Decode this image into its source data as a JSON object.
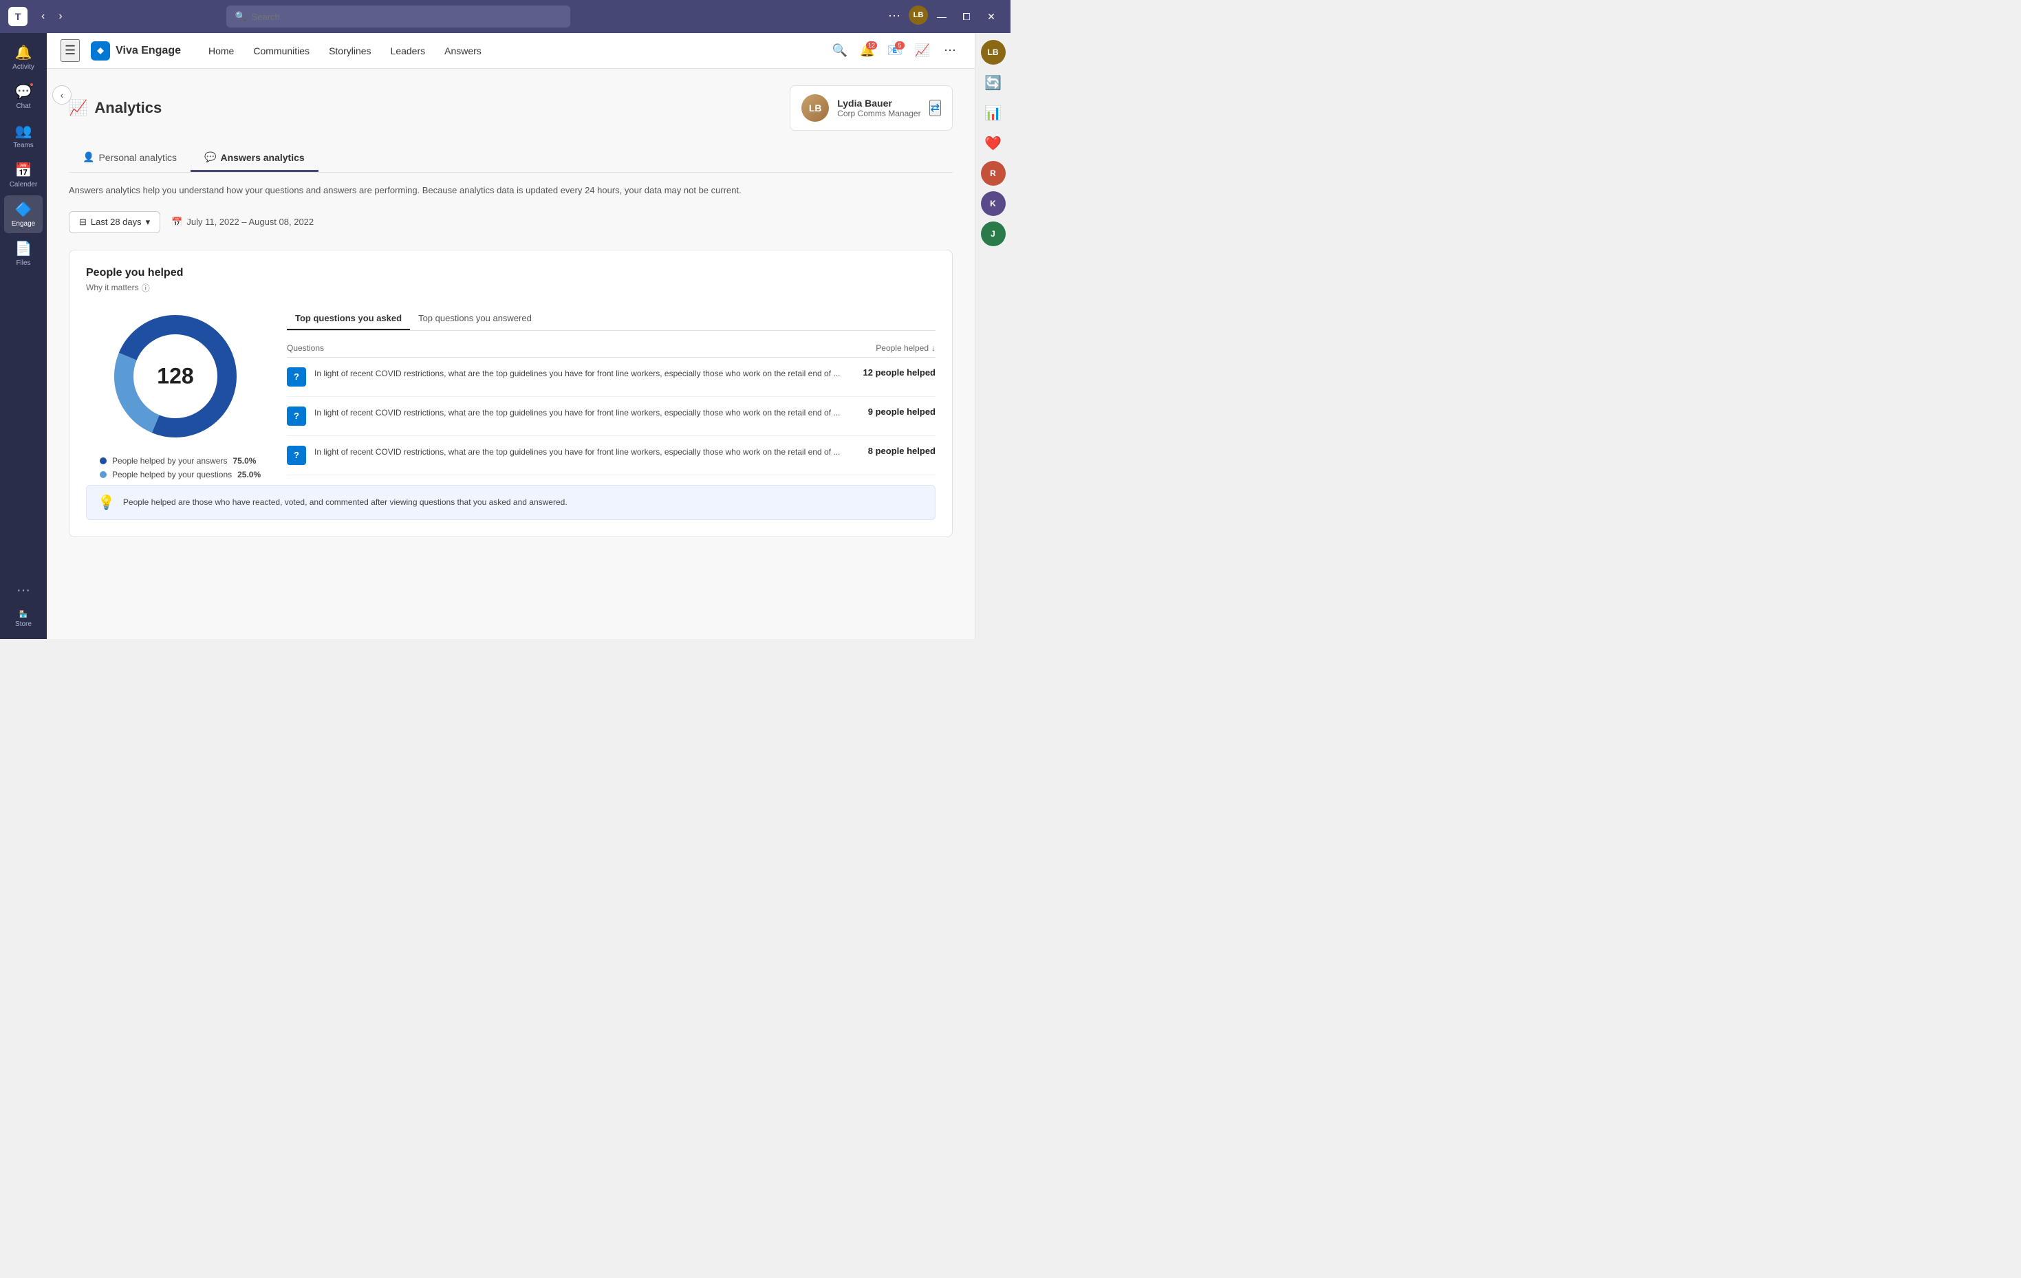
{
  "titlebar": {
    "search_placeholder": "Search",
    "nav_back": "‹",
    "nav_forward": "›",
    "minimize": "—",
    "maximize": "⧠",
    "close": "✕",
    "more": "···"
  },
  "left_sidebar": {
    "items": [
      {
        "id": "activity",
        "label": "Activity",
        "icon": "🔔",
        "badge": null
      },
      {
        "id": "chat",
        "label": "Chat",
        "icon": "💬",
        "badge": "1"
      },
      {
        "id": "teams",
        "label": "Teams",
        "icon": "👥",
        "badge": null
      },
      {
        "id": "calendar",
        "label": "Calender",
        "icon": "📅",
        "badge": null
      },
      {
        "id": "engage",
        "label": "Engage",
        "icon": "🔷",
        "badge": null,
        "active": true
      },
      {
        "id": "files",
        "label": "Files",
        "icon": "📄",
        "badge": null
      }
    ],
    "more_label": "···",
    "store_label": "Store"
  },
  "top_nav": {
    "app_name": "Viva Engage",
    "links": [
      "Home",
      "Communities",
      "Storylines",
      "Leaders",
      "Answers"
    ],
    "search_icon": "🔍",
    "notifications_badge": "12",
    "mail_badge": "5"
  },
  "page": {
    "back_btn": "‹",
    "title": "Analytics",
    "tabs": [
      {
        "id": "personal",
        "label": "Personal analytics",
        "active": false
      },
      {
        "id": "answers",
        "label": "Answers analytics",
        "active": true
      }
    ],
    "description": "Answers analytics help you understand how your questions and answers are performing.\nBecause analytics data is updated every 24 hours, your data may not be current.",
    "filter": {
      "label": "Last 28 days",
      "date_range": "July 11, 2022 – August 08, 2022"
    },
    "user_card": {
      "name": "Lydia Bauer",
      "role": "Corp Comms Manager",
      "initials": "LB"
    },
    "section": {
      "title": "People you helped",
      "subtitle": "Why it matters",
      "donut": {
        "center_value": "128",
        "segments": [
          {
            "label": "People helped by your answers",
            "value": "75.0%",
            "color": "#1e4fa0",
            "pct": 75
          },
          {
            "label": "People helped by your questions",
            "value": "25.0%",
            "color": "#5b9bd5",
            "pct": 25
          }
        ]
      },
      "inner_tabs": [
        {
          "id": "asked",
          "label": "Top questions you asked",
          "active": true
        },
        {
          "id": "answered",
          "label": "Top questions you answered",
          "active": false
        }
      ],
      "table_header": {
        "col1": "Questions",
        "col2": "People helped"
      },
      "rows": [
        {
          "question": "In light of recent COVID restrictions, what are the top guidelines you have for front line workers, especially those who work on the retail end of ...",
          "people_helped": "12 people helped"
        },
        {
          "question": "In light of recent COVID restrictions, what are the top guidelines you have for front line workers, especially those who work on the retail end of ...",
          "people_helped": "9 people helped"
        },
        {
          "question": "In light of recent COVID restrictions, what are the top guidelines you have for front line workers, especially those who work on the retail end of ...",
          "people_helped": "8 people helped"
        }
      ],
      "info_text": "People helped are those who have reacted, voted, and commented after viewing questions that you asked and answered."
    }
  },
  "right_sidebar": {
    "items": [
      {
        "id": "user1",
        "bg": "#8b6914",
        "initials": "LB"
      },
      {
        "id": "refresh",
        "icon": "🔄"
      },
      {
        "id": "chart",
        "icon": "📊"
      },
      {
        "id": "heart",
        "icon": "❤️"
      },
      {
        "id": "user2",
        "bg": "#c4523a",
        "initials": "R"
      },
      {
        "id": "user3",
        "bg": "#5b4a8a",
        "initials": "K"
      },
      {
        "id": "user4",
        "bg": "#2a7a4a",
        "initials": "J"
      }
    ]
  }
}
